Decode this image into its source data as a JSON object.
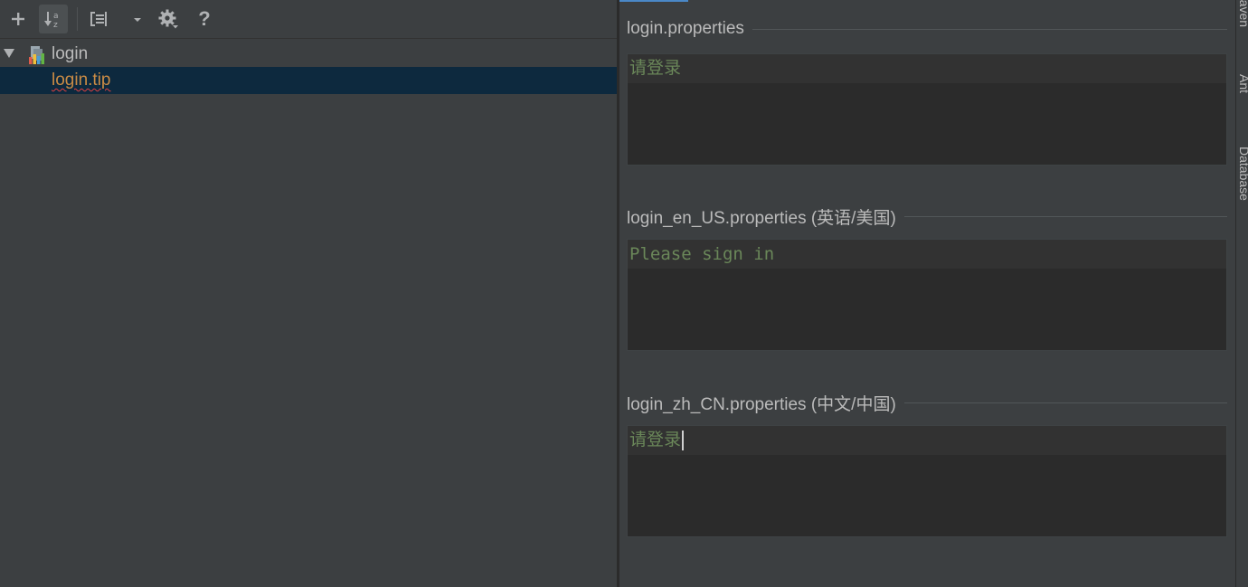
{
  "toolbar": {
    "add_icon": "plus-icon",
    "sort_icon": "sort-alphabetically-icon",
    "group_icon": "group-by-icon",
    "settings_icon": "gear-icon",
    "help_label": "?"
  },
  "tree": {
    "group_label": "login",
    "leaf_label": "login.tip"
  },
  "sections": [
    {
      "title": "login.properties",
      "value": "请登录"
    },
    {
      "title": "login_en_US.properties (英语/美国)",
      "value": "Please sign in"
    },
    {
      "title": "login_zh_CN.properties (中文/中国)",
      "value": "请登录"
    }
  ],
  "tool_strip": {
    "items": [
      "Maven",
      "Ant",
      "Database"
    ]
  },
  "colors": {
    "panel_bg": "#3c3f41",
    "editor_bg": "#2b2b2b",
    "string_value": "#6a8759",
    "selection": "#0d293e",
    "key_orange": "#c98b45"
  }
}
